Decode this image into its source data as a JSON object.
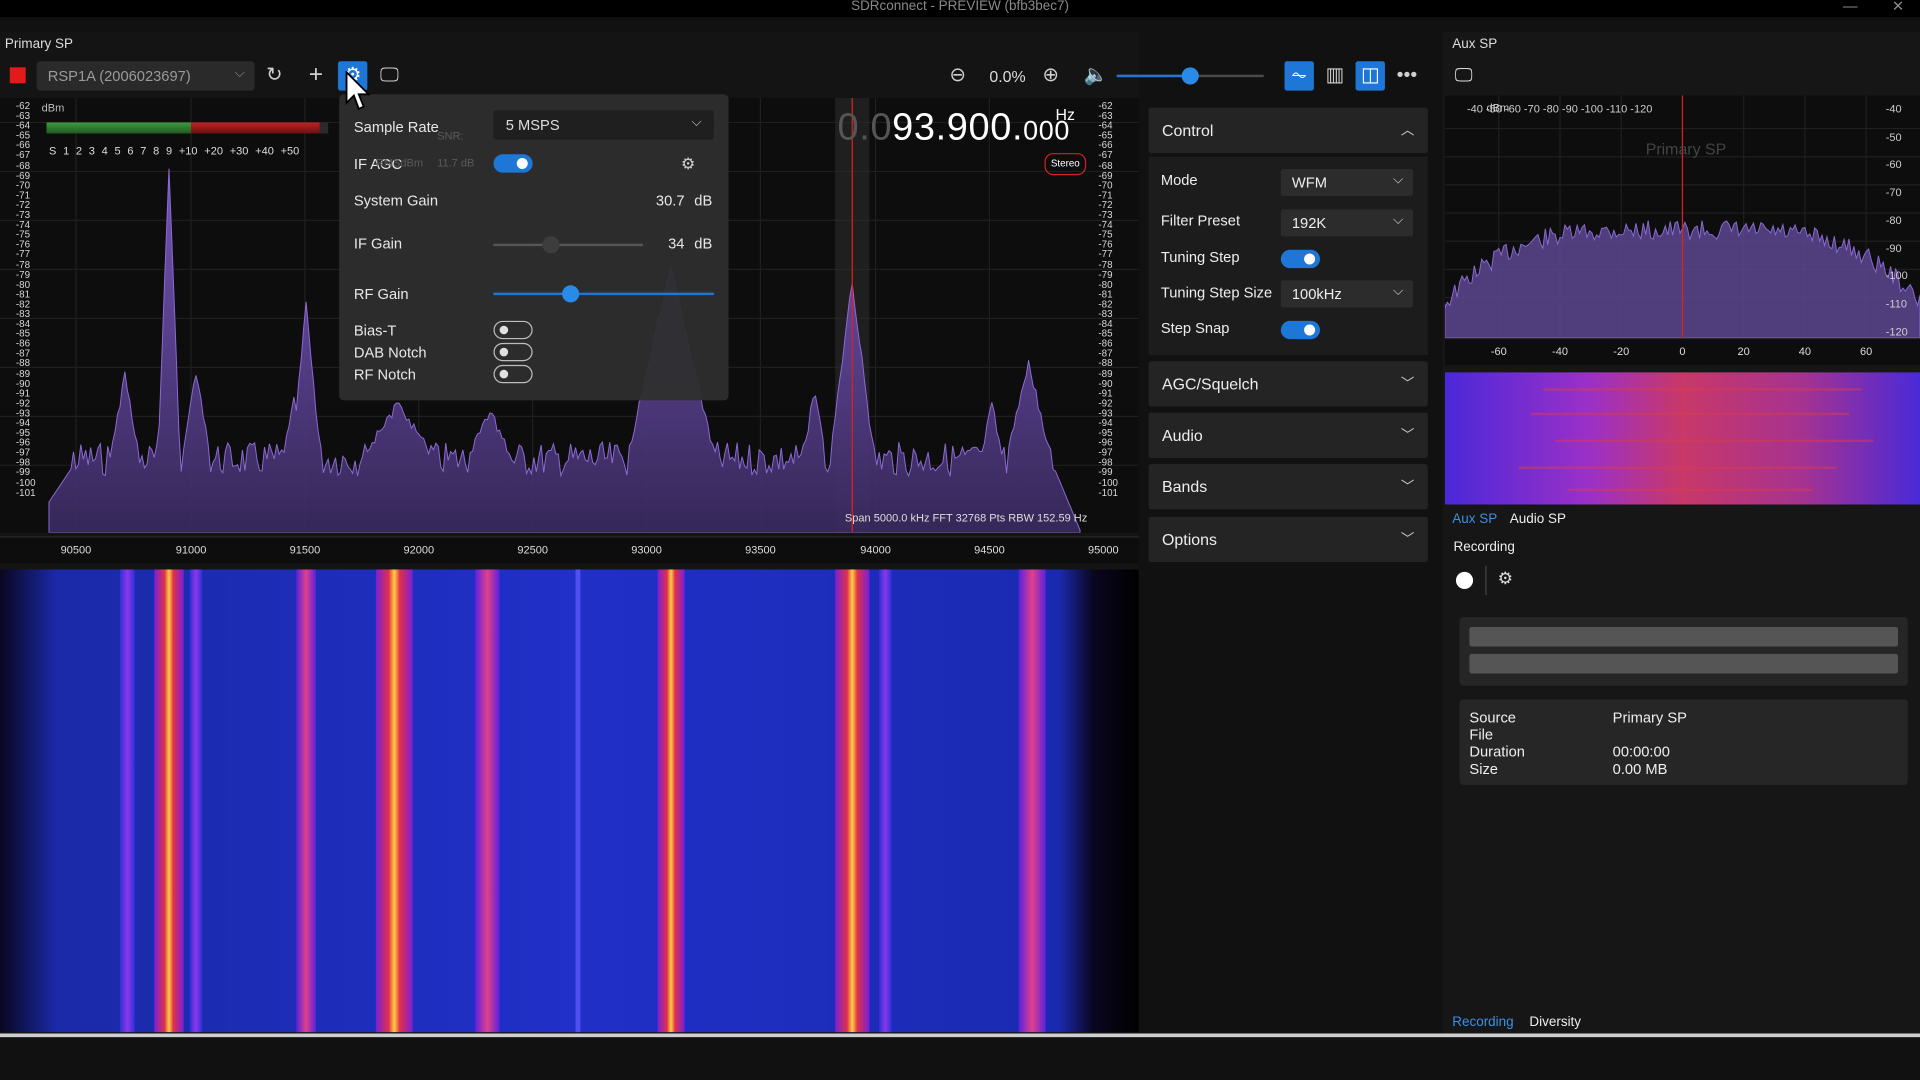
{
  "window": {
    "title": "SDRconnect - PREVIEW (bfb3bec7)",
    "controls": [
      "—",
      "✕"
    ]
  },
  "primary": {
    "title": "Primary SP",
    "toolbar": {
      "device": "RSP1A (2006023697)",
      "zoom_level": "0.0%",
      "volume_level": 0.5
    },
    "spectrum": {
      "unit": "dBm",
      "y_labels": [
        "-62",
        "-63",
        "-64",
        "-65",
        "-66",
        "-67",
        "-68",
        "-69",
        "-70",
        "-71",
        "-72",
        "-73",
        "-74",
        "-75",
        "-76",
        "-77",
        "-78",
        "-79",
        "-80",
        "-81",
        "-82",
        "-83",
        "-84",
        "-85",
        "-86",
        "-87",
        "-88",
        "-89",
        "-90",
        "-91",
        "-92",
        "-93",
        "-94",
        "-95",
        "-96",
        "-97",
        "-98",
        "-99",
        "-100",
        "-101"
      ],
      "smeter_scale": "S 1 2 3 4 5 6 7 8 9 +10 +20 +30 +40 +50",
      "frequency_dim": "0.0",
      "frequency_main": "93.900.",
      "frequency_small": "000",
      "frequency_unit": "Hz",
      "stereo": "Stereo",
      "span_info": "Span 5000.0 kHz FFT 32768 Pts  RBW 152.59 Hz",
      "x_labels": [
        "90500",
        "91000",
        "91500",
        "92000",
        "92500",
        "93000",
        "93500",
        "94000",
        "94500",
        "95000"
      ]
    }
  },
  "popup": {
    "sample_rate_label": "Sample Rate",
    "sample_rate_value": "5 MSPS",
    "if_agc_label": "IF AGC",
    "system_gain_label": "System Gain",
    "system_gain_value": "30.7",
    "system_gain_unit": "dB",
    "if_gain_label": "IF Gain",
    "if_gain_value": "34",
    "if_gain_unit": "dB",
    "rf_gain_label": "RF Gain",
    "rf_gain_level": 0.35,
    "bias_t_label": "Bias-T",
    "dab_notch_label": "DAB Notch",
    "rf_notch_label": "RF Notch",
    "ghost_rms": "RMS",
    "ghost_snr": "SNR:",
    "ghost_dbm": "dBm",
    "ghost_db": "11.7 dB"
  },
  "control": {
    "title": "Control",
    "mode_label": "Mode",
    "mode_value": "WFM",
    "filter_label": "Filter Preset",
    "filter_value": "192K",
    "tuning_step_label": "Tuning Step",
    "tuning_step_size_label": "Tuning Step Size",
    "tuning_step_size_value": "100kHz",
    "step_snap_label": "Step Snap",
    "sections": [
      "AGC/Squelch",
      "Audio",
      "Bands",
      "Options"
    ]
  },
  "aux": {
    "title": "Aux SP",
    "unit": "dBm",
    "watermark": "Primary SP",
    "y_labels": [
      "-40",
      "-50",
      "-60",
      "-70",
      "-80",
      "-90",
      "-100",
      "-110",
      "-120"
    ],
    "x_labels": [
      "-60",
      "-40",
      "-20",
      "0",
      "20",
      "40",
      "60"
    ],
    "tabs": [
      "Aux SP",
      "Audio SP"
    ],
    "recording": {
      "title": "Recording",
      "source_label": "Source",
      "source_value": "Primary SP",
      "file_label": "File",
      "duration_label": "Duration",
      "duration_value": "00:00:00",
      "size_label": "Size",
      "size_value": "0.00 MB"
    },
    "bottom_tabs": [
      "Recording",
      "Diversity"
    ]
  },
  "colors": {
    "accent": "#1e77d6",
    "spectrum_fill": "#6a4ba8",
    "tuning_line": "#e02020",
    "stop": "#e41a1a"
  },
  "icons": [
    "stop-icon",
    "refresh-icon",
    "add-icon",
    "settings-icon",
    "display-icon",
    "zoom-out-icon",
    "zoom-in-icon",
    "volume-icon",
    "spectrum-view-icon",
    "waterfall-view-icon",
    "split-view-icon",
    "more-icon",
    "gear-icon",
    "chevron-down-icon",
    "chevron-up-icon",
    "record-icon"
  ]
}
